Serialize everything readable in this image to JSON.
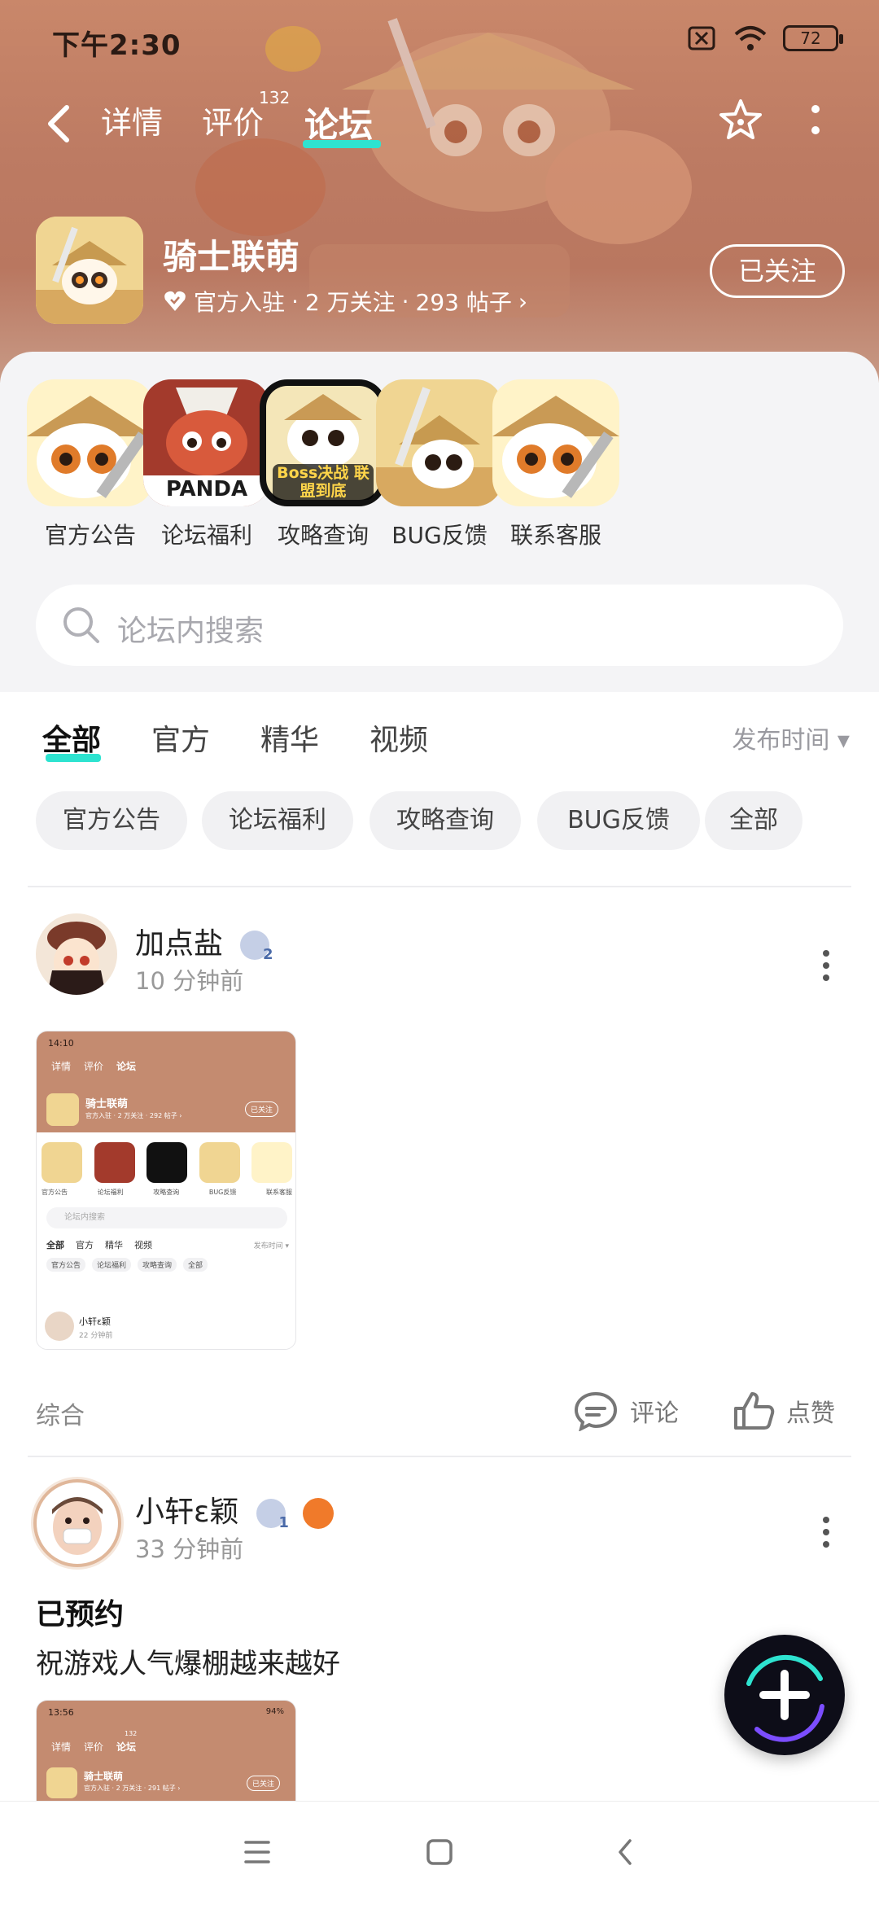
{
  "status_bar": {
    "time": "下午2:30",
    "battery": "72"
  },
  "top_nav": {
    "tabs": [
      {
        "label": "详情",
        "active": false
      },
      {
        "label": "评价",
        "active": false,
        "badge": "132"
      },
      {
        "label": "论坛",
        "active": true
      }
    ]
  },
  "forum": {
    "name": "骑士联萌",
    "official": "官方入驻",
    "followers": "2 万关注",
    "posts": "293 帖子",
    "follow_label": "已关注",
    "sep": "·",
    "chevron": "›"
  },
  "quick_links": [
    {
      "label": "官方公告",
      "icon": "panda-knight-icon"
    },
    {
      "label": "论坛福利",
      "icon": "panda-dragon-icon",
      "caption": "PANDA"
    },
    {
      "label": "攻略查询",
      "icon": "boss-guide-icon",
      "caption": "Boss决战 联盟到底"
    },
    {
      "label": "BUG反馈",
      "icon": "panda-sword-icon"
    },
    {
      "label": "联系客服",
      "icon": "panda-knight-icon"
    }
  ],
  "search": {
    "placeholder": "论坛内搜索"
  },
  "feed_tabs": [
    {
      "label": "全部",
      "active": true
    },
    {
      "label": "官方",
      "active": false
    },
    {
      "label": "精华",
      "active": false
    },
    {
      "label": "视频",
      "active": false
    }
  ],
  "sort_label": "发布时间 ▾",
  "chips": [
    "官方公告",
    "论坛福利",
    "攻略查询",
    "BUG反馈",
    "全部"
  ],
  "posts": [
    {
      "user": "加点盐",
      "level": "2",
      "time": "10 分钟前",
      "category": "综合",
      "comment_label": "评论",
      "like_label": "点赞"
    },
    {
      "user": "小轩ɛ颖",
      "level": "1",
      "time": "33 分钟前",
      "title": "已预约",
      "body": "祝游戏人气爆棚越来越好"
    }
  ],
  "thumb": {
    "time_a": "14:10",
    "time_b": "13:56",
    "tabs": [
      "详情",
      "评价",
      "论坛"
    ],
    "name": "骑士联萌",
    "meta": "官方入驻 · 2 万关注 · 292 帖子 ›",
    "follow": "已关注",
    "quick": [
      "官方公告",
      "论坛福利",
      "攻略查询",
      "BUG反馈",
      "联系客服"
    ],
    "search": "论坛内搜索",
    "feed": [
      "全部",
      "官方",
      "精华",
      "视频"
    ],
    "sort": "发布时间 ▾",
    "chips": [
      "官方公告",
      "论坛福利",
      "攻略查询",
      "全部"
    ],
    "user": "小轩ɛ颖",
    "time": "22 分钟前",
    "badge_b": "94%",
    "meta_b": "官方入驻 · 2 万关注 · 291 帖子 ›",
    "review_count": "132"
  },
  "colors": {
    "accent": "#2ee3d0",
    "hero": "#bd7b63"
  }
}
